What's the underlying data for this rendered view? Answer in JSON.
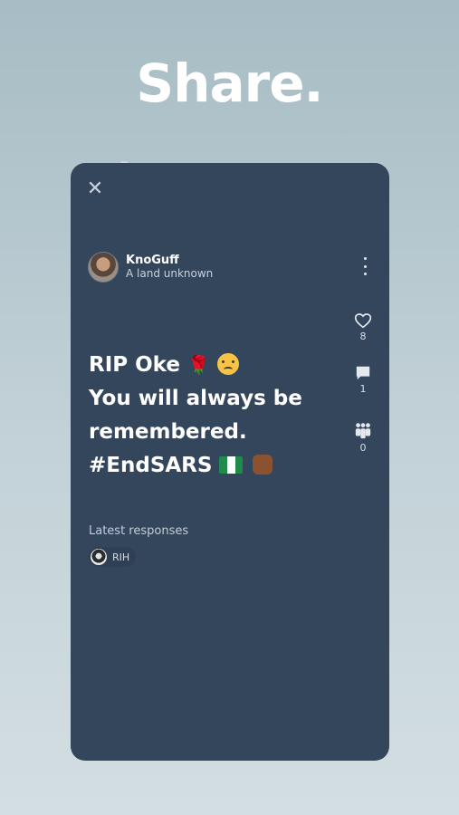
{
  "headline": "Share.",
  "close_icon": "close-icon",
  "post": {
    "author": {
      "name": "KnoGuff",
      "subtitle": "A land unknown"
    },
    "lines": [
      "RIP Oke",
      "You will always be",
      "remembered.",
      "#EndSARS"
    ],
    "emoji": {
      "rose": "rose-emoji",
      "tear": "crying-face-emoji",
      "flag": "nigeria-flag-emoji",
      "fist": "raised-fist-emoji"
    },
    "likes": "8",
    "comments": "1",
    "participants": "0"
  },
  "latest": {
    "label": "Latest responses",
    "responses": [
      {
        "name": "RIH"
      }
    ]
  },
  "colors": {
    "card": "#34465c",
    "background_top": "#a7bcc4",
    "background_bottom": "#d3dee2",
    "flag_green": "#1f8a4c",
    "flag_white": "#ffffff"
  }
}
